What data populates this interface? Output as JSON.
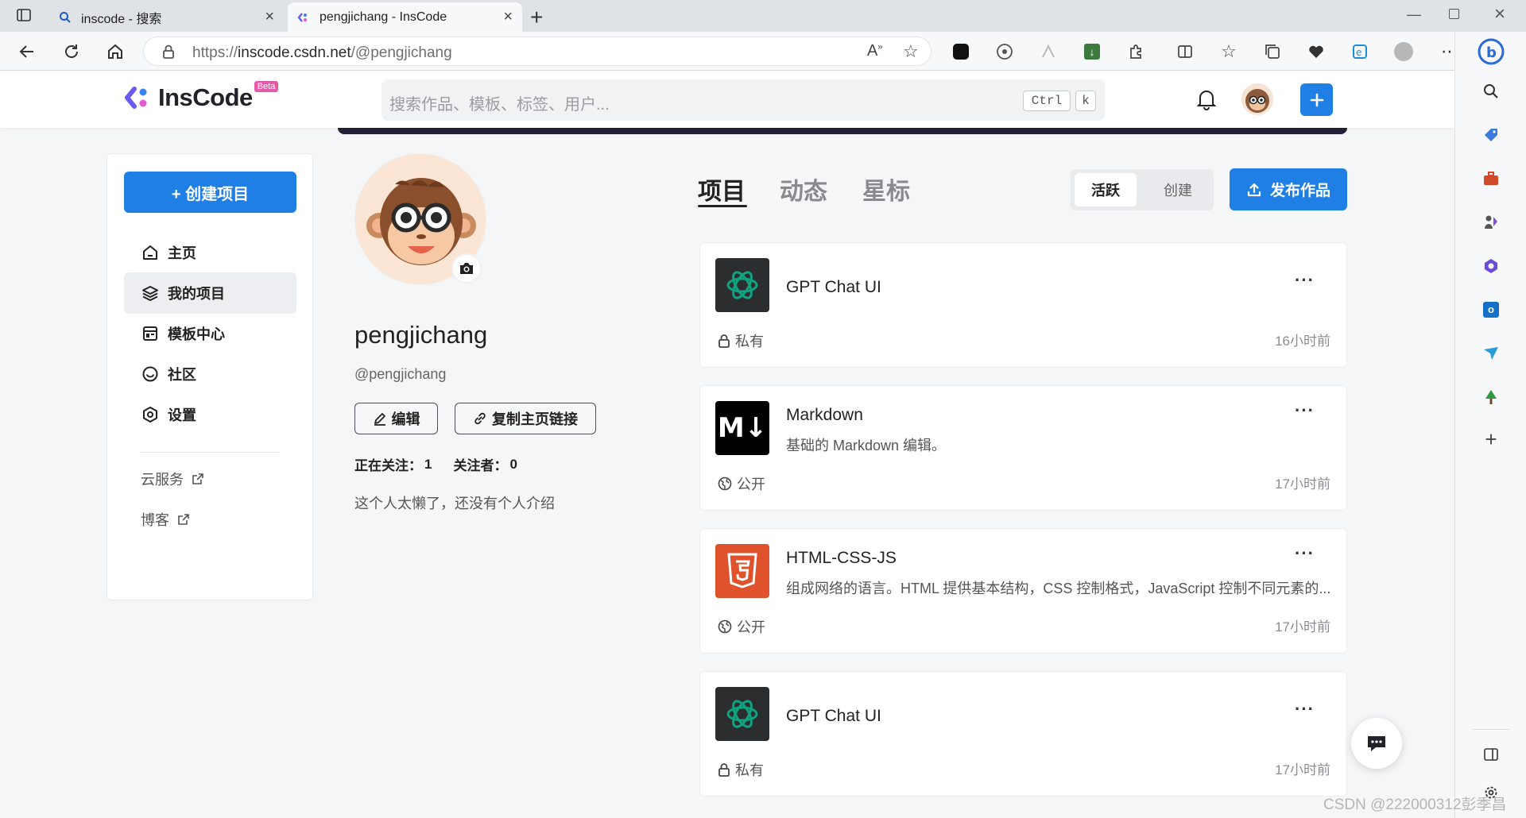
{
  "browser": {
    "tabs": [
      {
        "label": "inscode - 搜索",
        "icon": "search-icon"
      },
      {
        "label": "pengjichang - InsCode",
        "icon": "inscode-favicon"
      }
    ],
    "url_prefix": "https://",
    "url_host": "inscode.csdn.net",
    "url_path": "/@pengjichang"
  },
  "header": {
    "logo_text": "InsCode",
    "beta_badge": "Beta",
    "search_placeholder": "搜索作品、模板、标签、用户...",
    "kbd_ctrl": "Ctrl",
    "kbd_k": "k"
  },
  "sidebar": {
    "create_button": "+ 创建项目",
    "items": [
      {
        "label": "主页",
        "icon": "home-icon"
      },
      {
        "label": "我的项目",
        "icon": "layers-icon",
        "active": true
      },
      {
        "label": "模板中心",
        "icon": "template-icon"
      },
      {
        "label": "社区",
        "icon": "community-icon"
      },
      {
        "label": "设置",
        "icon": "settings-icon"
      }
    ],
    "links": [
      {
        "label": "云服务",
        "icon": "external-link-icon"
      },
      {
        "label": "博客",
        "icon": "external-link-icon"
      }
    ]
  },
  "profile": {
    "name": "pengjichang",
    "handle": "@pengjichang",
    "edit_button": "编辑",
    "copy_link_button": "复制主页链接",
    "following_label": "正在关注：",
    "following_count": "1",
    "followers_label": "关注者：",
    "followers_count": "0",
    "bio": "这个人太懒了，还没有个人介绍"
  },
  "content": {
    "tabs": [
      "项目",
      "动态",
      "星标"
    ],
    "active_tab": "项目",
    "sort_active": "活跃",
    "sort_other": "创建",
    "publish_button": "发布作品",
    "projects": [
      {
        "title": "GPT Chat UI",
        "description": "",
        "visibility": "私有",
        "time": "16小时前",
        "icon": "openai-icon"
      },
      {
        "title": "Markdown",
        "description": "基础的 Markdown 编辑。",
        "visibility": "公开",
        "time": "17小时前",
        "icon": "markdown-icon"
      },
      {
        "title": "HTML-CSS-JS",
        "description": "组成网络的语言。HTML 提供基本结构，CSS 控制格式，JavaScript 控制不同元素的...",
        "visibility": "公开",
        "time": "17小时前",
        "icon": "html5-icon"
      },
      {
        "title": "GPT Chat UI",
        "description": "",
        "visibility": "私有",
        "time": "17小时前",
        "icon": "openai-icon"
      }
    ]
  },
  "watermark": "CSDN @222000312彭季昌",
  "colors": {
    "accent": "#1f7fe5",
    "banner": "#22203a"
  }
}
